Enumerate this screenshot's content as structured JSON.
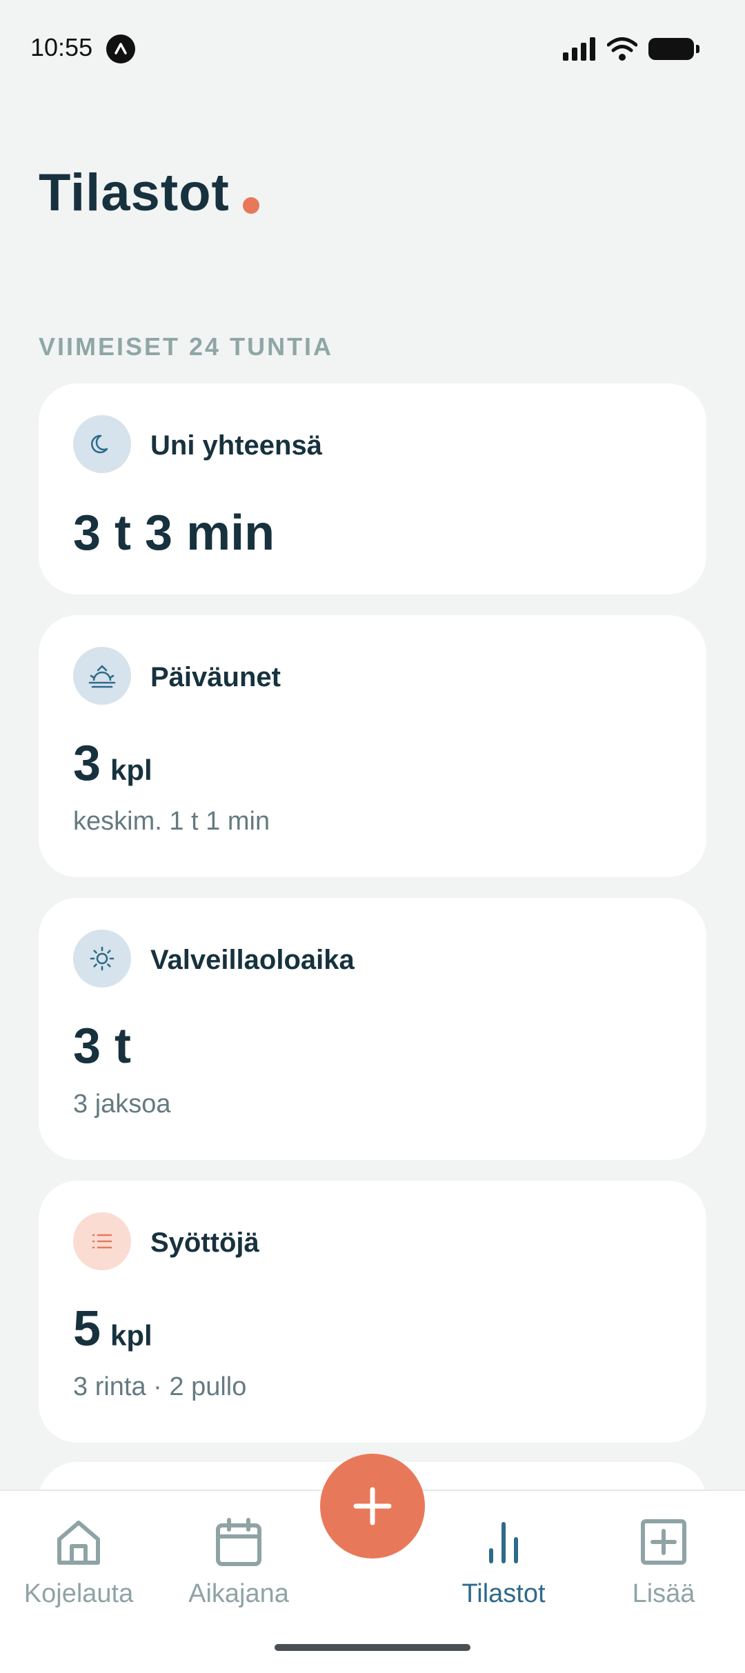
{
  "status": {
    "time": "10:55"
  },
  "page": {
    "title": "Tilastot",
    "section_label": "VIIMEISET 24 TUNTIA"
  },
  "cards": [
    {
      "icon": "moon-icon",
      "title": "Uni yhteensä",
      "value": "3 t 3 min"
    },
    {
      "icon": "sunrise-icon",
      "title": "Päiväunet",
      "value": "3",
      "unit": "kpl",
      "sub": "keskim. 1 t 1 min"
    },
    {
      "icon": "sun-icon",
      "title": "Valveillaoloaika",
      "value": "3 t",
      "sub": "3 jaksoa"
    },
    {
      "icon": "list-icon",
      "title": "Syöttöjä",
      "value": "5",
      "unit": "kpl",
      "sub": "3 rinta · 2 pullo"
    }
  ],
  "nav": {
    "items": [
      {
        "label": "Kojelauta",
        "icon": "home-icon"
      },
      {
        "label": "Aikajana",
        "icon": "calendar-icon"
      },
      {
        "label": "Tilastot",
        "icon": "bar-chart-icon",
        "active": true
      },
      {
        "label": "Lisää",
        "icon": "plus-square-icon"
      }
    ],
    "fab_icon": "plus-icon"
  },
  "colors": {
    "accent": "#e8785a",
    "primary": "#17323e",
    "active_nav": "#2e6a8a",
    "muted": "#8fa6a6",
    "background": "#f1f4f3"
  }
}
